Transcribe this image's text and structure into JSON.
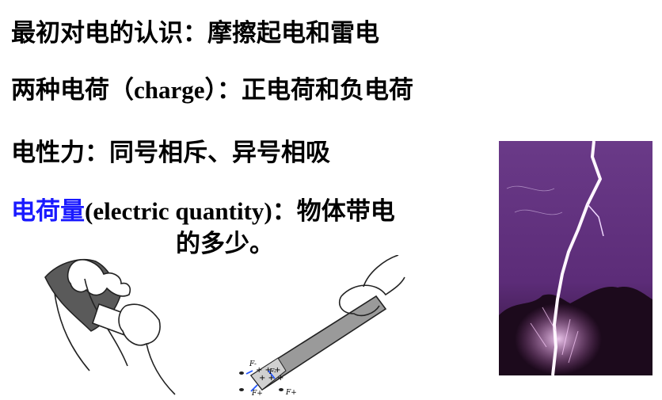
{
  "lines": {
    "l1": "最初对电的认识：摩擦起电和雷电",
    "l2_prefix": "两种电荷（",
    "l2_term": "charge",
    "l2_suffix": "）：正电荷和负电荷",
    "l3": "电性力：同号相斥、异号相吸",
    "l4_term": "电荷量",
    "l4_en": "(electric quantity)",
    "l4_rest": "：物体带电",
    "l4_cont": "的多少。"
  },
  "illustration": {
    "rod_signs": [
      "+",
      "+",
      "+",
      "+",
      "+",
      "+"
    ],
    "force_labels": [
      "F-",
      "F-",
      "F+",
      "F+"
    ]
  },
  "colors": {
    "highlight_term": "#1a1aff",
    "lightning_bg": "#5a2a7a",
    "bolt": "#fff6ff"
  },
  "icons": [
    "hands-rubbing-cloth-illustration",
    "hand-holding-rod-illustration",
    "lightning-photo"
  ]
}
